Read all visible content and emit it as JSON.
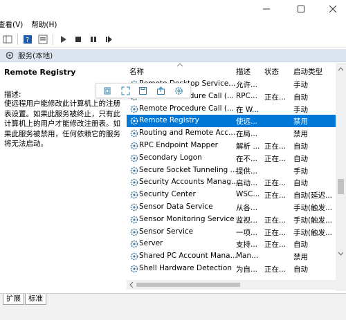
{
  "menu": {
    "view": "查看(V)",
    "help": "帮助(H)"
  },
  "header": {
    "label": "服务(本地)"
  },
  "left_panel": {
    "title": "Remote Registry",
    "desc_label": "描述:",
    "desc": "使远程用户能修改此计算机上的注册表设置。如果此服务被终止，只有此计算机上的用户才能修改注册表。如果此服务被禁用，任何依赖它的服务将无法启动。"
  },
  "columns": {
    "name": "名称",
    "desc": "描述",
    "status": "状态",
    "startup": "启动类型"
  },
  "rows": [
    {
      "name": "Remote Desktop Service...",
      "desc": "允许...",
      "status": "",
      "startup": "手动"
    },
    {
      "name": "Remote Procedure Call (...",
      "desc": "RPC...",
      "status": "正在...",
      "startup": "自动"
    },
    {
      "name": "Remote Procedure Call (...",
      "desc": "在 W...",
      "status": "",
      "startup": "手动"
    },
    {
      "name": "Remote Registry",
      "desc": "使远...",
      "status": "",
      "startup": "禁用",
      "selected": true
    },
    {
      "name": "Routing and Remote Acc...",
      "desc": "在局...",
      "status": "",
      "startup": "禁用"
    },
    {
      "name": "RPC Endpoint Mapper",
      "desc": "解析 ...",
      "status": "正在...",
      "startup": "自动"
    },
    {
      "name": "Secondary Logon",
      "desc": "在不...",
      "status": "正在...",
      "startup": "自动"
    },
    {
      "name": "Secure Socket Tunneling ...",
      "desc": "提供...",
      "status": "",
      "startup": "手动"
    },
    {
      "name": "Security Accounts Manag...",
      "desc": "启动...",
      "status": "正在...",
      "startup": "自动"
    },
    {
      "name": "Security Center",
      "desc": "WSC...",
      "status": "正在...",
      "startup": "自动(延迟..."
    },
    {
      "name": "Sensor Data Service",
      "desc": "从各...",
      "status": "",
      "startup": "手动(触发..."
    },
    {
      "name": "Sensor Monitoring Service",
      "desc": "监视...",
      "status": "正在...",
      "startup": "手动(触发..."
    },
    {
      "name": "Sensor Service",
      "desc": "一项...",
      "status": "正在...",
      "startup": "手动(触发..."
    },
    {
      "name": "Server",
      "desc": "支持...",
      "status": "正在...",
      "startup": "自动"
    },
    {
      "name": "Shared PC Account Mana...",
      "desc": "Man...",
      "status": "",
      "startup": "禁用"
    },
    {
      "name": "Shell Hardware Detection",
      "desc": "为自...",
      "status": "正在...",
      "startup": "自动"
    }
  ],
  "tabs": {
    "extended": "扩展",
    "standard": "标准"
  },
  "colors": {
    "selection": "#0078d7",
    "header_strip": "#dde6f0"
  }
}
